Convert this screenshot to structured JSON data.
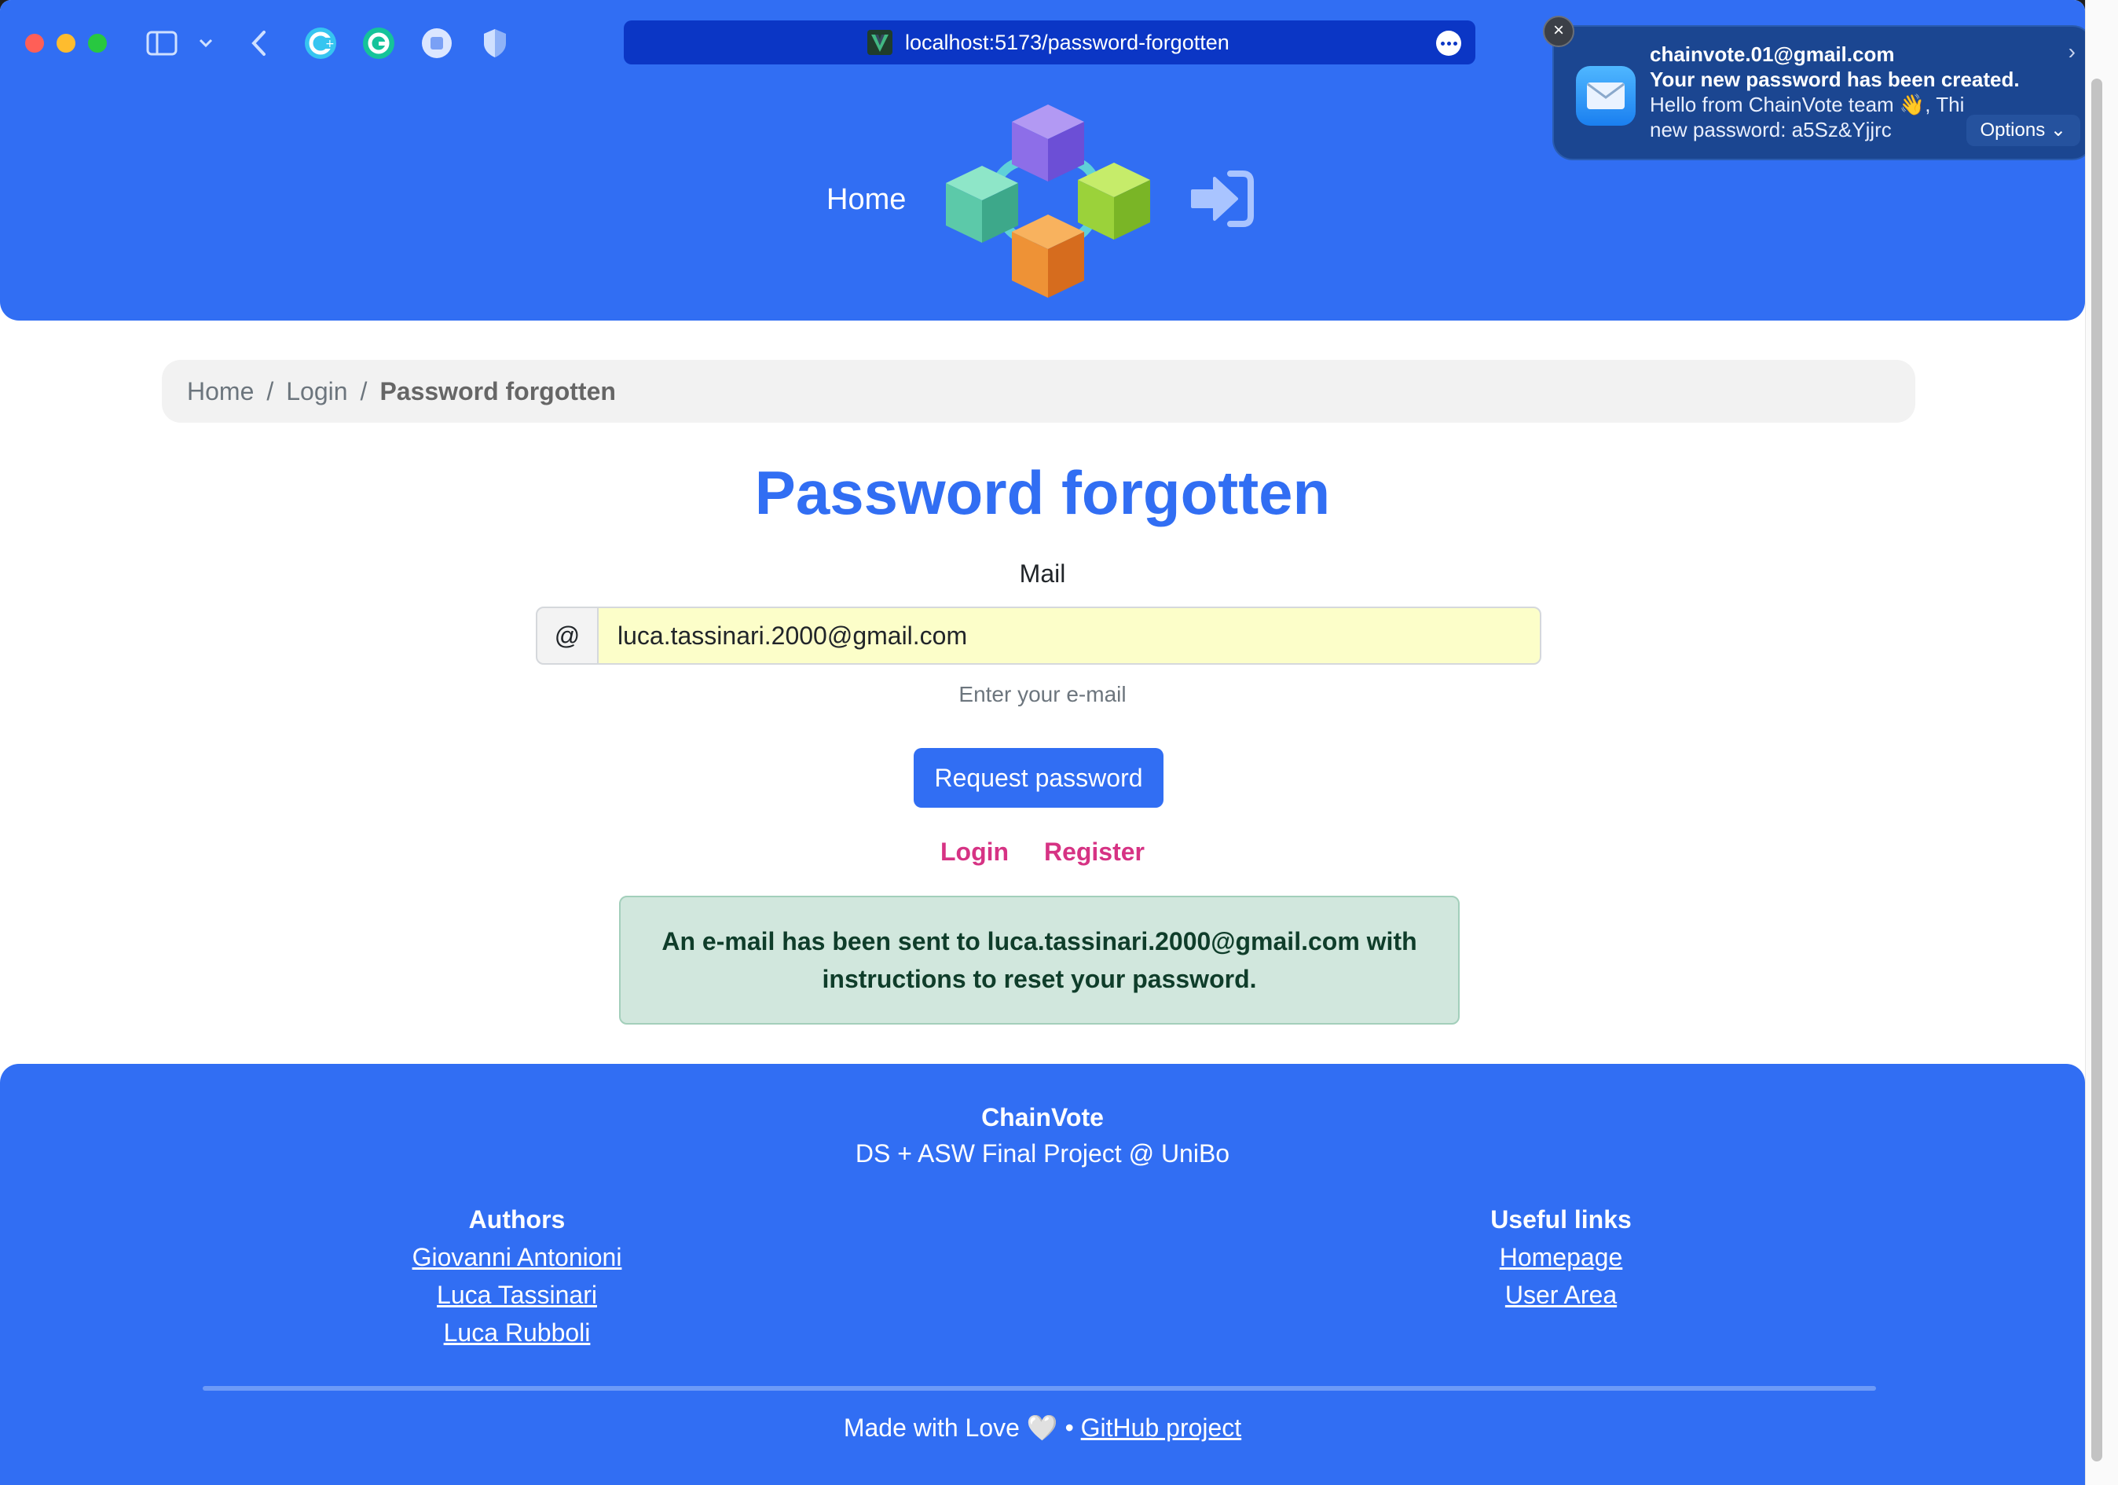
{
  "browser": {
    "url": "localhost:5173/password-forgotten"
  },
  "nav": {
    "home_label": "Home"
  },
  "notification": {
    "sender": "chainvote.01@gmail.com",
    "subject": "Your new password has been created.",
    "body_line1": "Hello from ChainVote team 👋, Thi",
    "body_line2": "new password: a5Sz&Yjjrc",
    "options_label": "Options ⌄",
    "close_symbol": "×",
    "chevron_symbol": "›"
  },
  "breadcrumb": {
    "items": [
      "Home",
      "Login",
      "Password forgotten"
    ],
    "separator": "/"
  },
  "form": {
    "title": "Password forgotten",
    "mail_label": "Mail",
    "at_symbol": "@",
    "email_value": "luca.tassinari.2000@gmail.com",
    "helper": "Enter your e-mail",
    "submit_label": "Request password",
    "login_link": "Login",
    "register_link": "Register"
  },
  "alert": {
    "message": "An e-mail has been sent to luca.tassinari.2000@gmail.com with instructions to reset your password."
  },
  "footer": {
    "brand": "ChainVote",
    "subtitle": "DS + ASW Final Project @ UniBo",
    "authors_heading": "Authors",
    "authors": [
      "Giovanni Antonioni",
      "Luca Tassinari",
      "Luca Rubboli"
    ],
    "links_heading": "Useful links",
    "links": [
      "Homepage",
      "User Area"
    ],
    "made_with": "Made with Love 🤍 •",
    "github_label": "GitHub project"
  },
  "colors": {
    "brand_blue": "#316ef3",
    "link_pink": "#d63384",
    "alert_green_bg": "#d1e7dd",
    "autofill_yellow": "#fcfec9"
  }
}
